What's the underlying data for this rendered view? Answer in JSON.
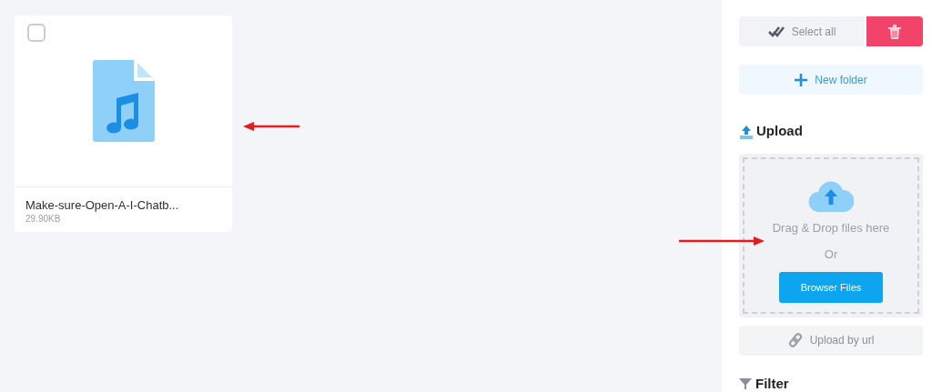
{
  "files": [
    {
      "name": "Make-sure-Open-A-I-Chatb...",
      "size": "29.90KB",
      "checked": false,
      "kind": "audio"
    }
  ],
  "sidebar": {
    "select_all": "Select all",
    "new_folder": "New folder",
    "upload": {
      "heading": "Upload",
      "drop_text": "Drag & Drop files here",
      "or": "Or",
      "browse_button": "Browser Files",
      "url_button": "Upload by url"
    },
    "filter_heading": "Filter"
  }
}
